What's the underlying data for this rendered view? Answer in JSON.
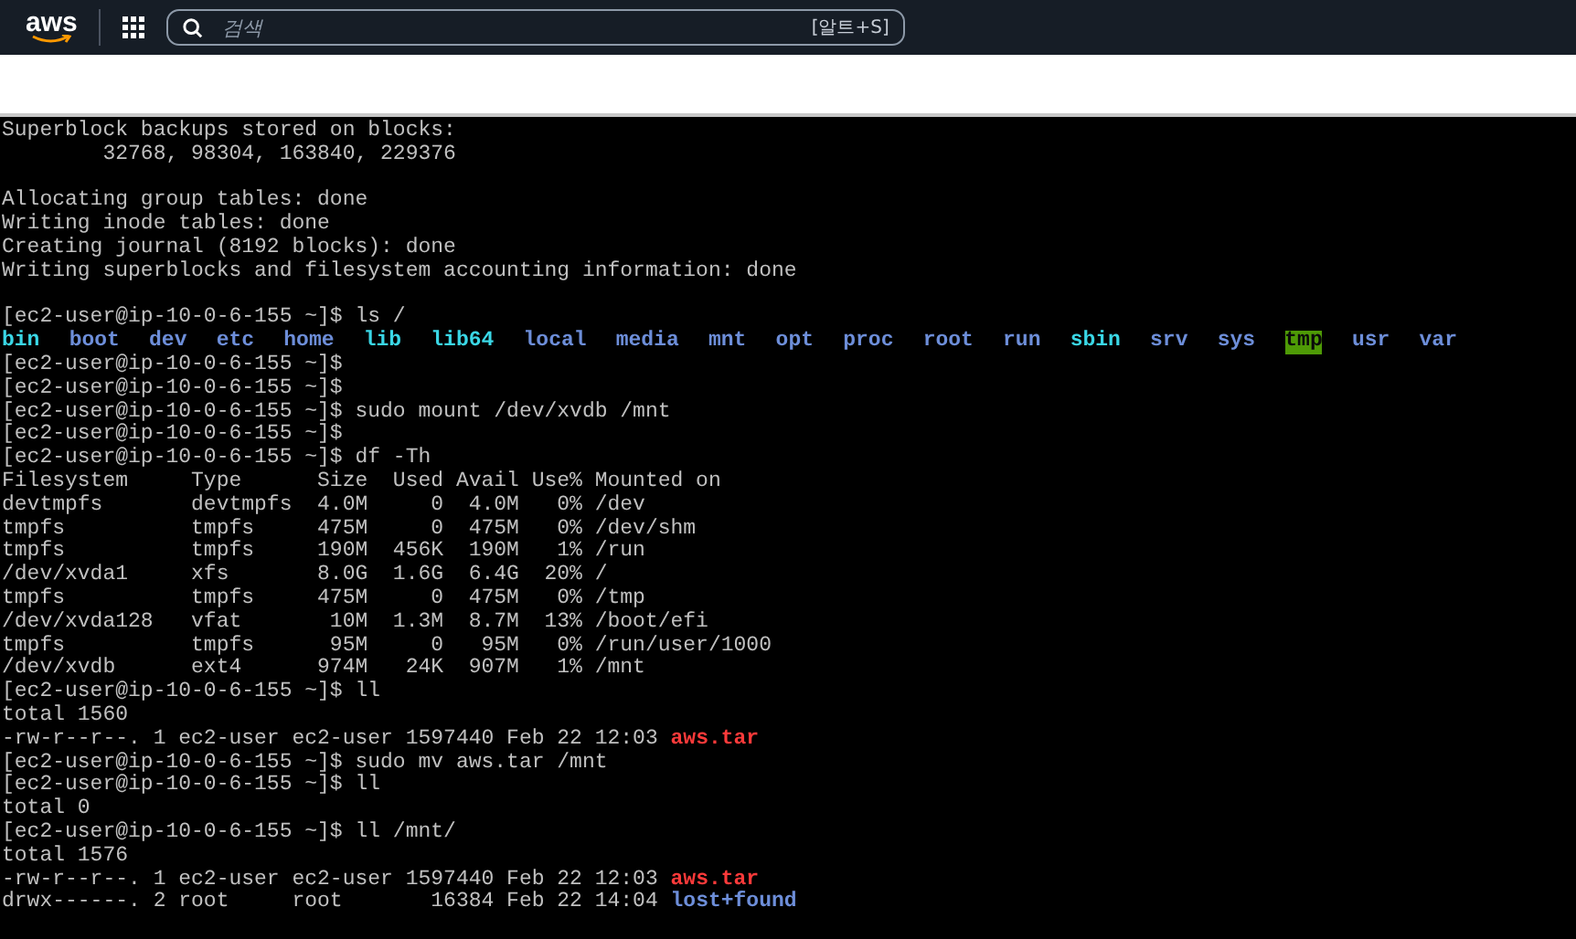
{
  "header": {
    "logo": "aws",
    "search": {
      "placeholder": "검색",
      "shortcut": "[알트+S]"
    }
  },
  "terminal": {
    "lines": [
      {
        "kind": "output",
        "segments": [
          {
            "text": "Superblock backups stored on blocks:",
            "kind": "plain"
          }
        ]
      },
      {
        "kind": "output",
        "segments": [
          {
            "text": "        32768, 98304, 163840, 229376",
            "kind": "plain"
          }
        ]
      },
      {
        "kind": "blank"
      },
      {
        "kind": "output",
        "segments": [
          {
            "text": "Allocating group tables: done",
            "kind": "plain"
          }
        ]
      },
      {
        "kind": "output",
        "segments": [
          {
            "text": "Writing inode tables: done",
            "kind": "plain"
          }
        ]
      },
      {
        "kind": "output",
        "segments": [
          {
            "text": "Creating journal (8192 blocks): done",
            "kind": "plain"
          }
        ]
      },
      {
        "kind": "output",
        "segments": [
          {
            "text": "Writing superblocks and filesystem accounting information: done",
            "kind": "plain"
          }
        ]
      },
      {
        "kind": "blank"
      },
      {
        "kind": "output",
        "segments": [
          {
            "text": "[ec2-user@ip-10-0-6-155 ~]$ ls /",
            "kind": "plain"
          }
        ]
      },
      {
        "kind": "listing",
        "segments": [
          {
            "text": "bin",
            "kind": "link"
          },
          {
            "text": "boot",
            "kind": "dir"
          },
          {
            "text": "dev",
            "kind": "dir"
          },
          {
            "text": "etc",
            "kind": "dir"
          },
          {
            "text": "home",
            "kind": "dir"
          },
          {
            "text": "lib",
            "kind": "link"
          },
          {
            "text": "lib64",
            "kind": "link"
          },
          {
            "text": "local",
            "kind": "dir"
          },
          {
            "text": "media",
            "kind": "dir"
          },
          {
            "text": "mnt",
            "kind": "dir"
          },
          {
            "text": "opt",
            "kind": "dir"
          },
          {
            "text": "proc",
            "kind": "dir"
          },
          {
            "text": "root",
            "kind": "dir"
          },
          {
            "text": "run",
            "kind": "dir"
          },
          {
            "text": "sbin",
            "kind": "link"
          },
          {
            "text": "srv",
            "kind": "dir"
          },
          {
            "text": "sys",
            "kind": "dir"
          },
          {
            "text": "tmp",
            "kind": "sticky"
          },
          {
            "text": "usr",
            "kind": "dir"
          },
          {
            "text": "var",
            "kind": "dir"
          }
        ]
      },
      {
        "kind": "output",
        "segments": [
          {
            "text": "[ec2-user@ip-10-0-6-155 ~]$",
            "kind": "plain"
          }
        ]
      },
      {
        "kind": "output",
        "segments": [
          {
            "text": "[ec2-user@ip-10-0-6-155 ~]$",
            "kind": "plain"
          }
        ]
      },
      {
        "kind": "output",
        "segments": [
          {
            "text": "[ec2-user@ip-10-0-6-155 ~]$ sudo mount /dev/xvdb /mnt",
            "kind": "plain"
          }
        ]
      },
      {
        "kind": "output",
        "segments": [
          {
            "text": "[ec2-user@ip-10-0-6-155 ~]$",
            "kind": "plain"
          }
        ]
      },
      {
        "kind": "output",
        "segments": [
          {
            "text": "[ec2-user@ip-10-0-6-155 ~]$ df -Th",
            "kind": "plain"
          }
        ]
      },
      {
        "kind": "output",
        "segments": [
          {
            "text": "Filesystem     Type      Size  Used Avail Use% Mounted on",
            "kind": "plain"
          }
        ]
      },
      {
        "kind": "output",
        "segments": [
          {
            "text": "devtmpfs       devtmpfs  4.0M     0  4.0M   0% /dev",
            "kind": "plain"
          }
        ]
      },
      {
        "kind": "output",
        "segments": [
          {
            "text": "tmpfs          tmpfs     475M     0  475M   0% /dev/shm",
            "kind": "plain"
          }
        ]
      },
      {
        "kind": "output",
        "segments": [
          {
            "text": "tmpfs          tmpfs     190M  456K  190M   1% /run",
            "kind": "plain"
          }
        ]
      },
      {
        "kind": "output",
        "segments": [
          {
            "text": "/dev/xvda1     xfs       8.0G  1.6G  6.4G  20% /",
            "kind": "plain"
          }
        ]
      },
      {
        "kind": "output",
        "segments": [
          {
            "text": "tmpfs          tmpfs     475M     0  475M   0% /tmp",
            "kind": "plain"
          }
        ]
      },
      {
        "kind": "output",
        "segments": [
          {
            "text": "/dev/xvda128   vfat       10M  1.3M  8.7M  13% /boot/efi",
            "kind": "plain"
          }
        ]
      },
      {
        "kind": "output",
        "segments": [
          {
            "text": "tmpfs          tmpfs      95M     0   95M   0% /run/user/1000",
            "kind": "plain"
          }
        ]
      },
      {
        "kind": "output",
        "segments": [
          {
            "text": "/dev/xvdb      ext4      974M   24K  907M   1% /mnt",
            "kind": "plain"
          }
        ]
      },
      {
        "kind": "output",
        "segments": [
          {
            "text": "[ec2-user@ip-10-0-6-155 ~]$ ll",
            "kind": "plain"
          }
        ]
      },
      {
        "kind": "output",
        "segments": [
          {
            "text": "total 1560",
            "kind": "plain"
          }
        ]
      },
      {
        "kind": "output",
        "segments": [
          {
            "text": "-rw-r--r--. 1 ec2-user ec2-user 1597440 Feb 22 12:03 ",
            "kind": "plain"
          },
          {
            "text": "aws.tar",
            "kind": "archive"
          }
        ]
      },
      {
        "kind": "output",
        "segments": [
          {
            "text": "[ec2-user@ip-10-0-6-155 ~]$ sudo mv aws.tar /mnt",
            "kind": "plain"
          }
        ]
      },
      {
        "kind": "output",
        "segments": [
          {
            "text": "[ec2-user@ip-10-0-6-155 ~]$ ll",
            "kind": "plain"
          }
        ]
      },
      {
        "kind": "output",
        "segments": [
          {
            "text": "total 0",
            "kind": "plain"
          }
        ]
      },
      {
        "kind": "output",
        "segments": [
          {
            "text": "[ec2-user@ip-10-0-6-155 ~]$ ll /mnt/",
            "kind": "plain"
          }
        ]
      },
      {
        "kind": "output",
        "segments": [
          {
            "text": "total 1576",
            "kind": "plain"
          }
        ]
      },
      {
        "kind": "output",
        "segments": [
          {
            "text": "-rw-r--r--. 1 ec2-user ec2-user 1597440 Feb 22 12:03 ",
            "kind": "plain"
          },
          {
            "text": "aws.tar",
            "kind": "archive"
          }
        ]
      },
      {
        "kind": "output",
        "segments": [
          {
            "text": "drwx------. 2 root     root       16384 Feb 22 14:04 ",
            "kind": "plain"
          },
          {
            "text": "lost+found",
            "kind": "dir"
          }
        ]
      }
    ]
  }
}
